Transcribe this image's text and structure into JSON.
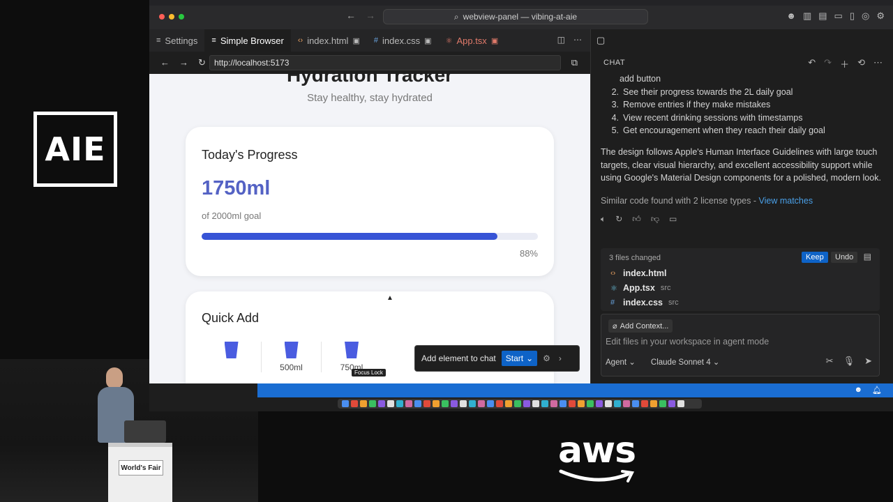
{
  "logos": {
    "aie": "AIE",
    "aws": "aws"
  },
  "speaker": {
    "podium_sign": "World's Fair"
  },
  "window": {
    "title": "webview-panel — vibing-at-aie",
    "traffic_colors": [
      "#ff5f57",
      "#febc2e",
      "#28c840"
    ]
  },
  "tabs": [
    {
      "label": "Settings",
      "icon": "gear-icon",
      "active": false
    },
    {
      "label": "Simple Browser",
      "icon": "browser-icon",
      "active": true
    },
    {
      "label": "index.html",
      "icon": "code-icon",
      "active": false
    },
    {
      "label": "index.css",
      "icon": "hash-icon",
      "active": false
    },
    {
      "label": "App.tsx",
      "icon": "react-icon",
      "active": false
    }
  ],
  "browser": {
    "url": "http://localhost:5173"
  },
  "app": {
    "title": "Hydration Tracker",
    "subtitle": "Stay healthy, stay hydrated",
    "progress_card": {
      "title": "Today's Progress",
      "amount": "1750ml",
      "goal": "of 2000ml goal",
      "percent_label": "88%",
      "percent": 88
    },
    "quick_add": {
      "title": "Quick Add",
      "items": [
        "",
        "500ml",
        "750ml"
      ]
    },
    "focus_lock": "Focus Lock"
  },
  "add_element": {
    "label": "Add element to chat",
    "start": "Start"
  },
  "chat": {
    "header": "CHAT",
    "list_cont": "add button",
    "list": [
      {
        "num": "2.",
        "text": "See their progress towards the 2L daily goal"
      },
      {
        "num": "3.",
        "text": "Remove entries if they make mistakes"
      },
      {
        "num": "4.",
        "text": "View recent drinking sessions with timestamps"
      },
      {
        "num": "5.",
        "text": "Get encouragement when they reach their daily goal"
      }
    ],
    "paragraph": "The design follows Apple's Human Interface Guidelines with large touch targets, clear visual hierarchy, and excellent accessibility support while using Google's Material Design components for a polished, modern look.",
    "similar": "Similar code found with 2 license types - ",
    "similar_link": "View matches",
    "files_changed": "3 files changed",
    "keep": "Keep",
    "undo": "Undo",
    "files": [
      {
        "name": "index.html",
        "loc": "",
        "icon": "code-icon"
      },
      {
        "name": "App.tsx",
        "loc": "src",
        "icon": "react-icon"
      },
      {
        "name": "index.css",
        "loc": "src",
        "icon": "hash-icon"
      }
    ],
    "add_context": "Add Context...",
    "input_placeholder": "Edit files in your workspace in agent mode",
    "mode": "Agent",
    "model": "Claude Sonnet 4"
  }
}
